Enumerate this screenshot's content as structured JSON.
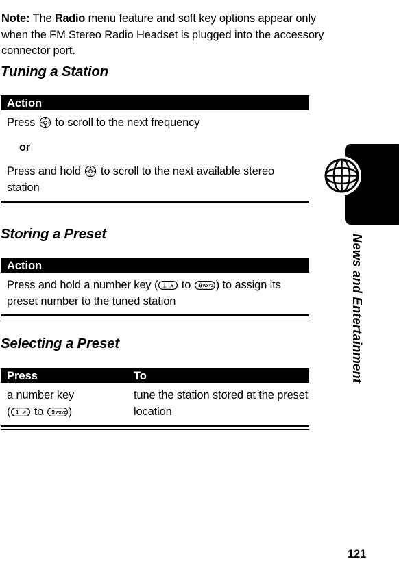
{
  "note": {
    "label": "Note:",
    "text_before": " The ",
    "emphasis": "Radio",
    "text_after": " menu feature and soft key options appear only when the FM Stereo Radio Headset is plugged into the accessory connector port."
  },
  "sections": [
    {
      "heading": "Tuning a Station",
      "table": {
        "headers": [
          "Action"
        ],
        "rows": [
          {
            "type": "text",
            "parts": [
              "Press ",
              "nav-key-icon",
              " to scroll to the next frequency"
            ]
          },
          {
            "type": "or",
            "parts": [
              "or"
            ]
          },
          {
            "type": "text",
            "parts": [
              "Press and hold ",
              "nav-key-icon",
              " to scroll to the next available stereo station"
            ]
          }
        ]
      }
    },
    {
      "heading": "Storing a Preset",
      "table": {
        "headers": [
          "Action"
        ],
        "rows": [
          {
            "type": "text",
            "parts": [
              "Press and hold a number key (",
              "key-1-icon",
              " to ",
              "key-9-icon",
              ") to assign its preset number to the tuned station"
            ]
          }
        ]
      }
    },
    {
      "heading": "Selecting a Preset",
      "table": {
        "headers": [
          "Press",
          "To"
        ],
        "rows": [
          {
            "type": "two-col",
            "col_a_line1": "a number key",
            "col_a_open": "(",
            "col_a_mid": " to ",
            "col_a_close": ")",
            "col_b": "tune the station stored at the preset location"
          }
        ]
      }
    }
  ],
  "keys": {
    "key_1_digit": "1",
    "key_1_letters": "",
    "key_9_digit": "9",
    "key_9_letters": "WXYZ"
  },
  "sidebar": {
    "label": "News and Entertainment",
    "icon": "globe-icon"
  },
  "footer": {
    "page_number": "121"
  },
  "colors": {
    "header_bar": "#000000",
    "header_text": "#ffffff",
    "body_text": "#000000",
    "background": "#ffffff"
  }
}
